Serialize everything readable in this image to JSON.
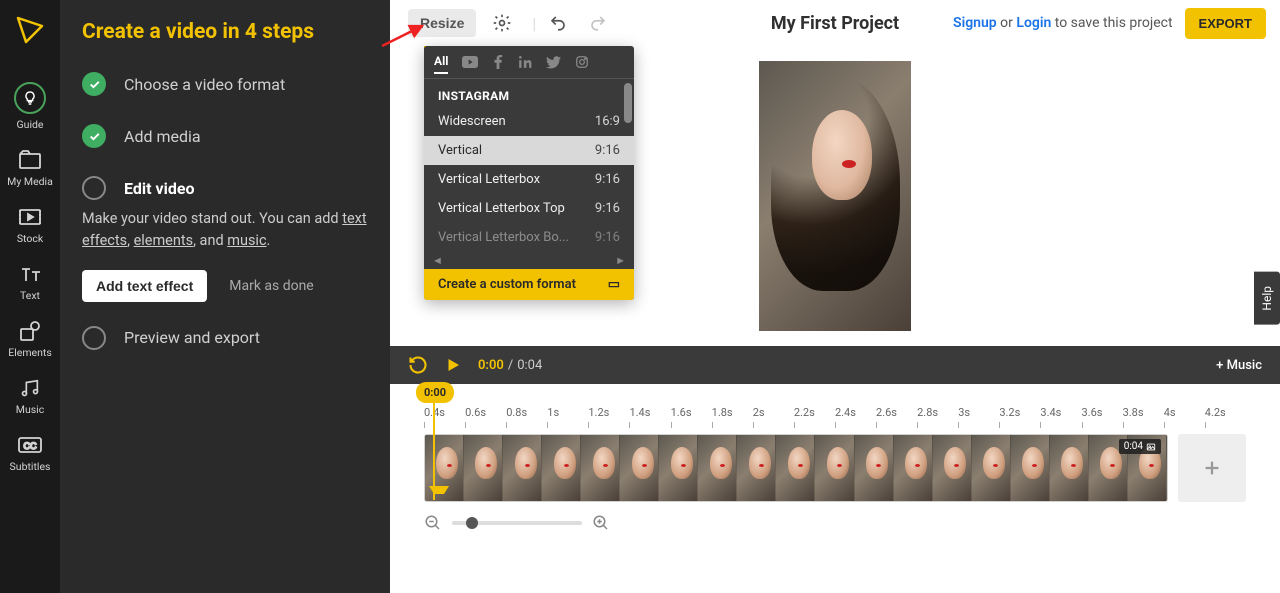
{
  "rail": {
    "items": [
      {
        "label": "Guide"
      },
      {
        "label": "My Media"
      },
      {
        "label": "Stock"
      },
      {
        "label": "Text"
      },
      {
        "label": "Elements"
      },
      {
        "label": "Music"
      },
      {
        "label": "Subtitles"
      }
    ]
  },
  "sidebar": {
    "title": "Create a video in 4 steps",
    "steps": [
      {
        "label": "Choose a video format"
      },
      {
        "label": "Add media"
      },
      {
        "label": "Edit video"
      },
      {
        "label": "Preview and export"
      }
    ],
    "desc_prefix": "Make your video stand out. You can add ",
    "link_text": "text effects",
    "link_elements": "elements",
    "desc_and": ", and ",
    "link_music": "music",
    "desc_end": ".",
    "add_text_effect": "Add text effect",
    "mark_done": "Mark as done"
  },
  "topbar": {
    "resize": "Resize",
    "project_title": "My First Project",
    "signup": "Signup",
    "or": " or ",
    "login": "Login",
    "save_msg": " to save this project",
    "export": "EXPORT"
  },
  "dropdown": {
    "tab_all": "All",
    "heading": "INSTAGRAM",
    "rows": [
      {
        "name": "Widescreen",
        "ratio": "16:9"
      },
      {
        "name": "Vertical",
        "ratio": "9:16"
      },
      {
        "name": "Vertical Letterbox",
        "ratio": "9:16"
      },
      {
        "name": "Vertical Letterbox Top",
        "ratio": "9:16"
      }
    ],
    "more": "Vertical Letterbox Bo...",
    "more_ratio": "9:16",
    "custom": "Create a custom format"
  },
  "playbar": {
    "current": "0:00",
    "sep": "  /  ",
    "total": "0:04",
    "music": "+ Music"
  },
  "timeline": {
    "playhead": "0:00",
    "marks": [
      "0.4s",
      "0.6s",
      "0.8s",
      "1s",
      "1.2s",
      "1.4s",
      "1.6s",
      "1.8s",
      "2s",
      "2.2s",
      "2.4s",
      "2.6s",
      "2.8s",
      "3s",
      "3.2s",
      "3.4s",
      "3.6s",
      "3.8s",
      "4s",
      "4.2s"
    ],
    "clip_duration": "0:04"
  },
  "help": "Help"
}
